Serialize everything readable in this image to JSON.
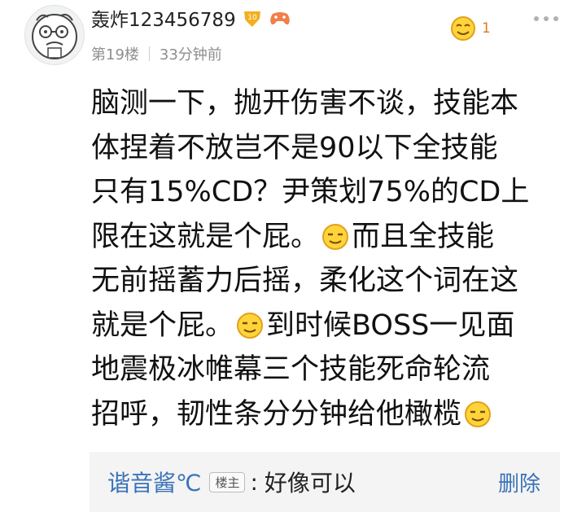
{
  "post": {
    "username": "轰炸123456789",
    "level_badge": "10",
    "floor": "第19楼",
    "time": "33分钟前",
    "like_count": "1",
    "content_lines": [
      "脑测一下，抛开伤害不谈，技能本",
      "体捏着不放岂不是90以下全技能",
      "只有15%CD？尹策划75%的CD上",
      "限在这就是个屁。",
      "而且全技能",
      "无前摇蓄力后摇，柔化这个词在这",
      "就是个屁。",
      "到时候BOSS一见面",
      "地震极冰帷幕三个技能死命轮流",
      "招呼，韧性条分分钟给他橄榄"
    ]
  },
  "reply": {
    "name": "谐音酱℃",
    "tag": "楼主",
    "colon": ":",
    "text": "好像可以",
    "delete_label": "删除"
  },
  "colors": {
    "link_blue": "#3a73b8",
    "meta_gray": "#8e8e8e",
    "like_orange": "#e07a1f",
    "reply_bg": "#f4f4f4"
  }
}
